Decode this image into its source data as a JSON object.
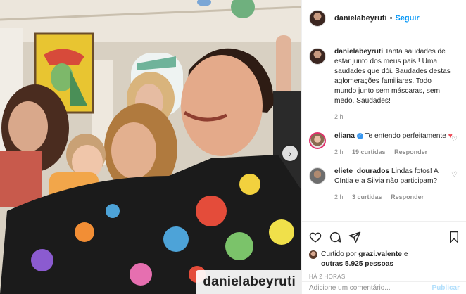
{
  "post": {
    "watermark": "danielabeyruti"
  },
  "header": {
    "username": "danielabeyruti",
    "separator": "•",
    "follow_label": "Seguir"
  },
  "caption": {
    "username": "danielabeyruti",
    "text": "Tanta saudades de estar junto dos meus pais!! Uma saudades que dói. Saudades destas aglomerações familiares. Todo mundo junto sem máscaras, sem medo. Saudades!",
    "time": "2 h"
  },
  "comments": [
    {
      "username": "eliana",
      "text": "Te entendo perfeitamente",
      "emoji": "♥",
      "time": "2 h",
      "likes": "19 curtidas",
      "reply": "Responder"
    },
    {
      "username": "eliete_dourados",
      "text": "Lindas fotos! A Cíntia e a Silvia não participam?",
      "time": "2 h",
      "likes": "3 curtidas",
      "reply": "Responder"
    }
  ],
  "likes": {
    "prefix": "Curtido por",
    "user": "grazi.valente",
    "and": "e",
    "others": "outras 5.925 pessoas"
  },
  "timestamp": "HÁ 2 HORAS",
  "add_comment": {
    "placeholder": "Adicione um comentário...",
    "publish": "Publicar"
  },
  "colors": {
    "link": "#0095f6",
    "muted": "#8e8e8e",
    "heart": "#ed4956",
    "verified": "#3897f0"
  }
}
